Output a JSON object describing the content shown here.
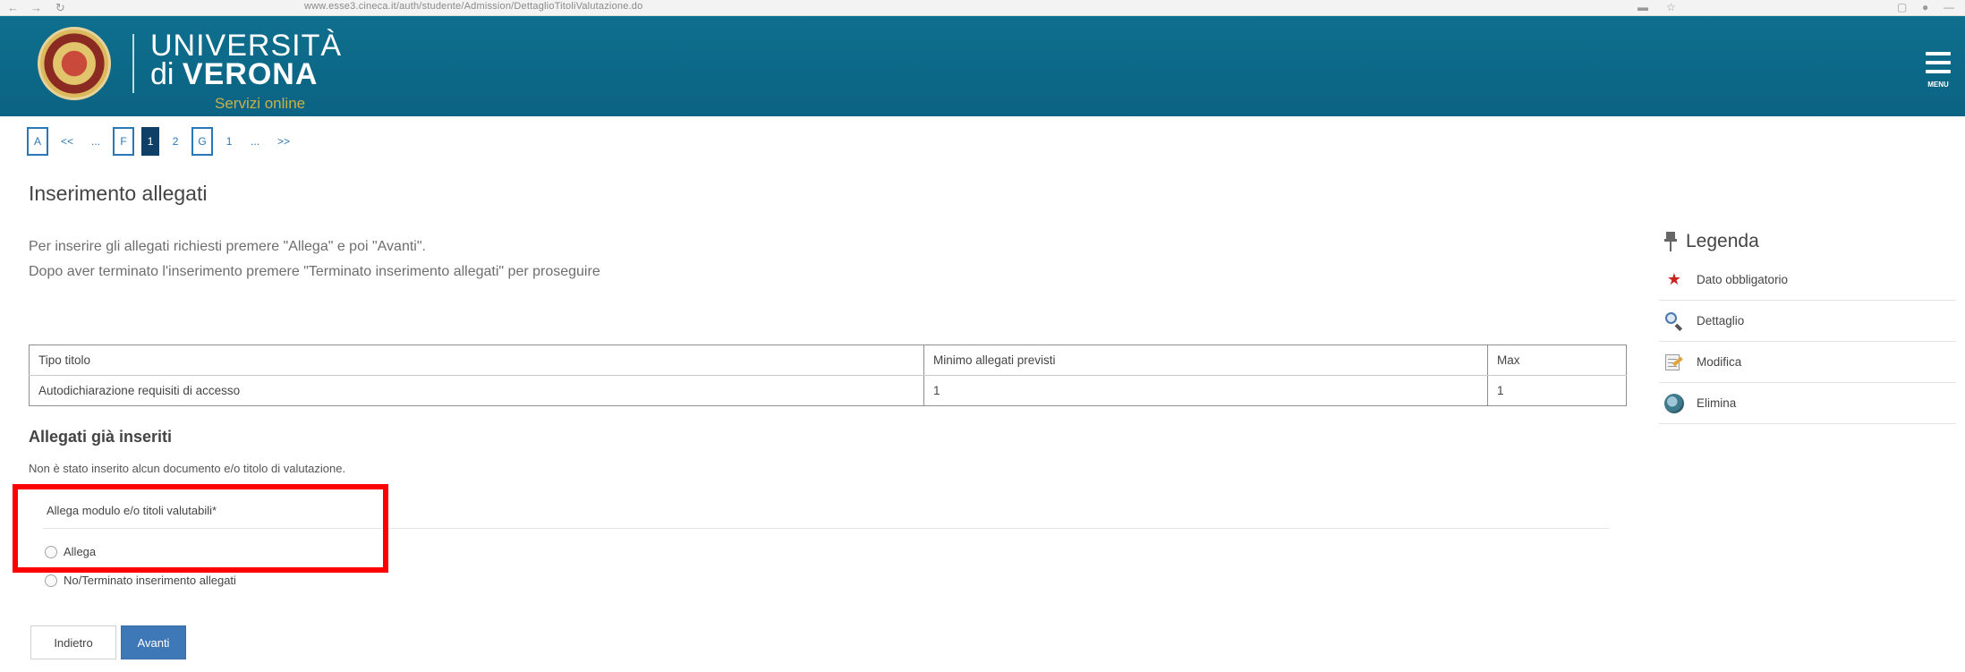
{
  "browser": {
    "back_glyph": "←",
    "forward_glyph": "→",
    "reload_glyph": "↻",
    "url": "www.esse3.cineca.it/auth/studente/Admission/DettaglioTitoliValutazione.do"
  },
  "header": {
    "brand_line1": "UNIVERSITÀ",
    "brand_line2_prefix": "di",
    "brand_line2_name": "VERONA",
    "brand_tagline": "Servizi online",
    "menu_label": "MENU",
    "colors": {
      "bar": "#0e6a8a",
      "tagline": "#c9b14a"
    }
  },
  "pager": {
    "items": [
      {
        "label": "A",
        "style": "box"
      },
      {
        "label": "<<",
        "style": "plain"
      },
      {
        "label": "...",
        "style": "plain"
      },
      {
        "label": "F",
        "style": "box"
      },
      {
        "label": "1",
        "style": "active"
      },
      {
        "label": "2",
        "style": "plain"
      },
      {
        "label": "G",
        "style": "box"
      },
      {
        "label": "1",
        "style": "plain"
      },
      {
        "label": "...",
        "style": "plain"
      },
      {
        "label": ">>",
        "style": "plain"
      }
    ],
    "colors": {
      "link": "#2a77b8",
      "active_bg": "#0f3e66"
    }
  },
  "main": {
    "title": "Inserimento allegati",
    "intro_line1": "Per inserire gli allegati richiesti premere \"Allega\" e poi \"Avanti\".",
    "intro_line2": "Dopo aver terminato l'inserimento premere \"Terminato inserimento allegati\" per proseguire",
    "table": {
      "headers": [
        "Tipo titolo",
        "Minimo allegati previsti",
        "Max"
      ],
      "rows": [
        [
          "Autodichiarazione requisiti di accesso",
          "1",
          "1"
        ]
      ]
    },
    "attached_title": "Allegati già inseriti",
    "no_documents": "Non è stato inserito alcun documento e/o titolo di valutazione.",
    "field_label": "Allega modulo e/o titoli valutabili*",
    "options": [
      {
        "label": "Allega",
        "selected": false
      },
      {
        "label": "No/Terminato inserimento allegati",
        "selected": false
      }
    ],
    "back_button": "Indietro",
    "next_button": "Avanti",
    "highlight_color": "#ff0000"
  },
  "legend": {
    "title": "Legenda",
    "items": [
      {
        "icon": "required-star-icon",
        "label": "Dato obbligatorio"
      },
      {
        "icon": "magnifier-icon",
        "label": "Dettaglio"
      },
      {
        "icon": "edit-icon",
        "label": "Modifica"
      },
      {
        "icon": "delete-icon",
        "label": "Elimina"
      }
    ]
  }
}
